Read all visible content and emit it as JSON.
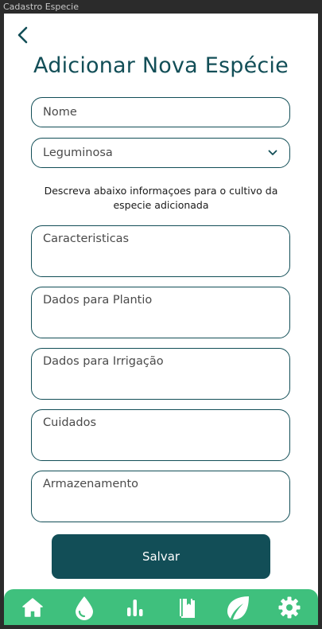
{
  "window": {
    "title": "Cadastro Especie"
  },
  "header": {
    "title": "Adicionar Nova Espécie"
  },
  "form": {
    "name_placeholder": "Nome",
    "type_selected": "Leguminosa",
    "instructions": "Descreva abaixo informaçoes para o cultivo da especie adicionada",
    "caracteristicas_placeholder": "Caracteristicas",
    "plantio_placeholder": "Dados para Plantio",
    "irrigacao_placeholder": "Dados para Irrigação",
    "cuidados_placeholder": "Cuidados",
    "armazenamento_placeholder": "Armazenamento",
    "save_label": "Salvar"
  },
  "bottom_nav": {
    "items": [
      {
        "icon": "home-icon"
      },
      {
        "icon": "water-drop-icon"
      },
      {
        "icon": "bar-chart-icon"
      },
      {
        "icon": "book-icon"
      },
      {
        "icon": "leaf-icon"
      },
      {
        "icon": "gear-icon"
      }
    ]
  },
  "colors": {
    "primary": "#124e57",
    "nav_background": "#3fc07d",
    "background": "#ffffff"
  }
}
